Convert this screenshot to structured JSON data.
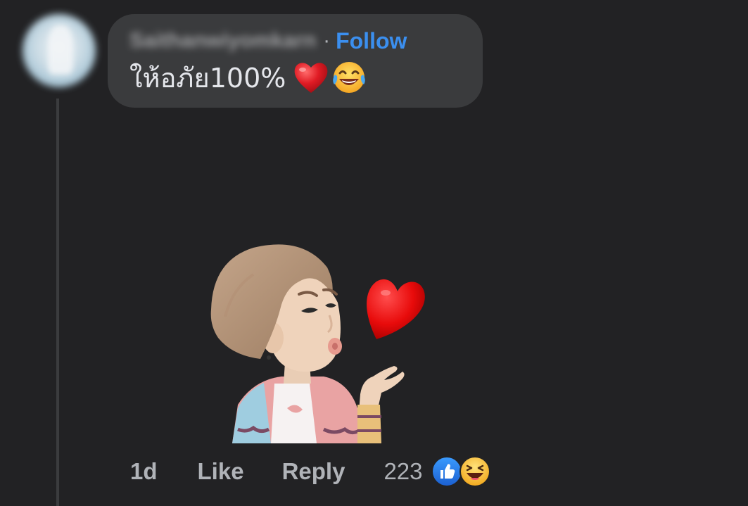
{
  "comment": {
    "author_name": "Saithanwiyomkarn",
    "separator": "·",
    "follow_label": "Follow",
    "text": "ให้อภัย100%",
    "text_emojis": [
      "red-heart-emoji",
      "tears-of-joy-emoji"
    ]
  },
  "sticker": {
    "icon": "avatar-blowing-kiss-sticker"
  },
  "footer": {
    "time": "1d",
    "like_label": "Like",
    "reply_label": "Reply",
    "reaction_count": "223",
    "reactions": [
      "like-reaction-icon",
      "haha-reaction-icon"
    ]
  },
  "colors": {
    "background": "#222224",
    "bubble": "#3a3b3d",
    "link": "#3b8fef",
    "muted_text": "#b0b3b8",
    "like_blue": "#1b74e4"
  }
}
